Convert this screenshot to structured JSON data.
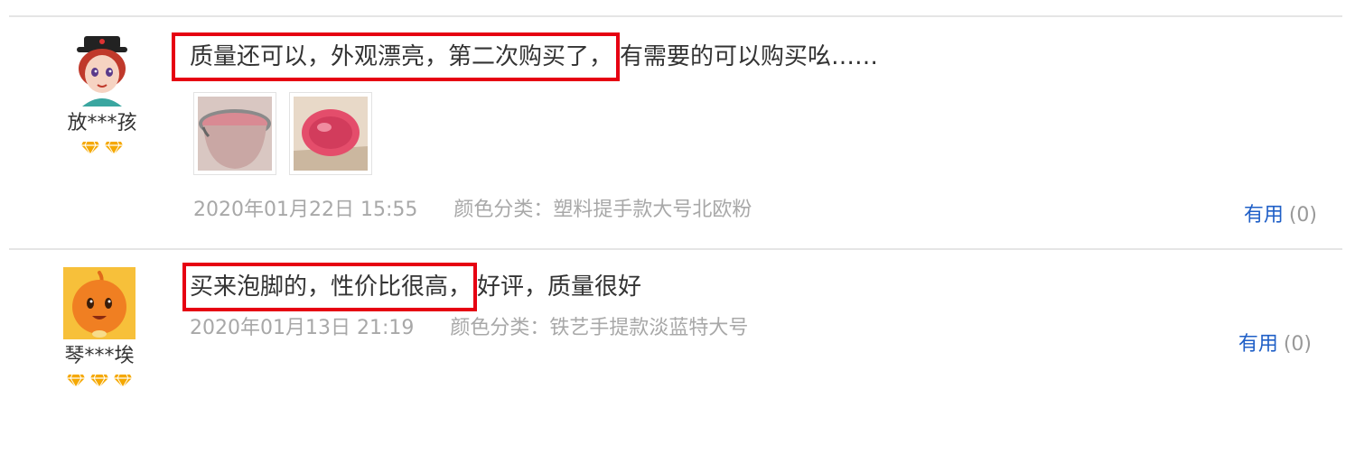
{
  "reviews": [
    {
      "username": "放***孩",
      "gem_count": 2,
      "comment_highlight": "质量还可以，外观漂亮，第二次购买了，",
      "comment_rest": "有需要的可以购买吆……",
      "images": [
        "pink-bucket-rim",
        "pink-bucket-inside"
      ],
      "date": "2020年01月22日 15:55",
      "spec": "颜色分类：塑料提手款大号北欧粉",
      "useful_label": "有用",
      "useful_count": "(0)"
    },
    {
      "username": "琴***埃",
      "gem_count": 3,
      "comment_highlight": "买来泡脚的，性价比很高，",
      "comment_rest": "好评，质量很好",
      "date": "2020年01月13日 21:19",
      "spec": "颜色分类：铁艺手提款淡蓝特大号",
      "useful_label": "有用",
      "useful_count": "(0)"
    }
  ],
  "colors": {
    "highlight_border": "#e60012",
    "useful_link": "#1f5fc7",
    "meta_text": "#a8a8a8",
    "gem": "#f5a800"
  }
}
